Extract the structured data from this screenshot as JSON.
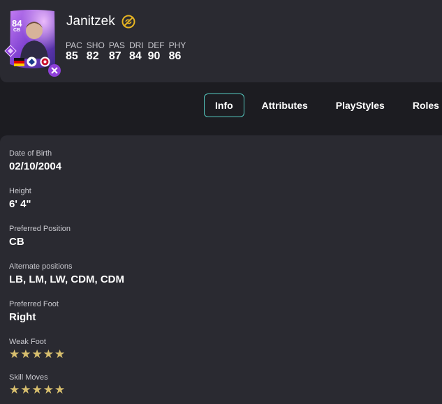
{
  "player": {
    "name": "Janitzek",
    "card_rating": "84",
    "card_position": "CB",
    "stats": [
      {
        "label": "PAC",
        "value": "85"
      },
      {
        "label": "SHO",
        "value": "82"
      },
      {
        "label": "PAS",
        "value": "87"
      },
      {
        "label": "DRI",
        "value": "84"
      },
      {
        "label": "DEF",
        "value": "90"
      },
      {
        "label": "PHY",
        "value": "86"
      }
    ],
    "icons": {
      "untradeable": "untradeable-icon",
      "nation": "germany-flag-icon",
      "league": "league-badge-icon",
      "club": "club-badge-icon",
      "rarity": "rarity-badge-icon",
      "chemistry_style": "chemistry-style-icon"
    }
  },
  "tabs": [
    {
      "label": "Info",
      "active": true
    },
    {
      "label": "Attributes",
      "active": false
    },
    {
      "label": "PlayStyles",
      "active": false
    },
    {
      "label": "Roles",
      "active": false
    }
  ],
  "info": {
    "dob_label": "Date of Birth",
    "dob_value": "02/10/2004",
    "height_label": "Height",
    "height_value": "6' 4\"",
    "pref_pos_label": "Preferred Position",
    "pref_pos_value": "CB",
    "alt_pos_label": "Alternate positions",
    "alt_pos_value": "LB, LM, LW, CDM, CDM",
    "foot_label": "Preferred Foot",
    "foot_value": "Right",
    "weak_foot_label": "Weak Foot",
    "weak_foot_stars": 5,
    "skill_moves_label": "Skill Moves",
    "skill_moves_stars": 5
  },
  "colors": {
    "accent": "#55c9c0",
    "star": "#d8bf6e",
    "card_purple": "#9b4fd6",
    "untradeable": "#e6b422"
  }
}
